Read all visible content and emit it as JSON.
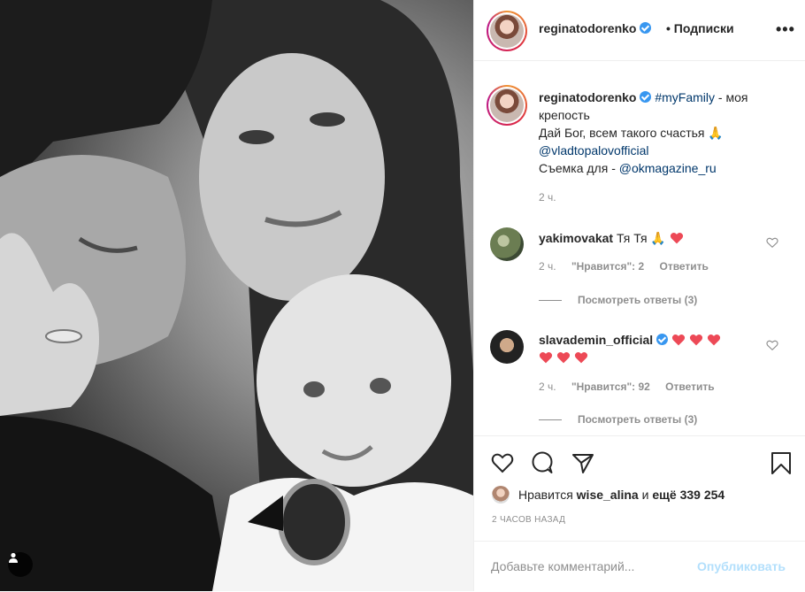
{
  "post": {
    "username": "reginatodorenko",
    "follow_separator": "•",
    "follow_label": "Подписки",
    "more_icon": "more-options-icon"
  },
  "caption": {
    "username": "reginatodorenko",
    "hashtag": "#myFamily",
    "line1_rest": " - моя крепость",
    "line2": "Дай Бог, всем такого счастья 🙏",
    "mention1": "@vladtopalovofficial",
    "line4_prefix": "Съемка для - ",
    "mention2": "@okmagazine_ru",
    "time": "2 ч."
  },
  "comments": [
    {
      "username": "yakimovakat",
      "text": "Тя Тя 🙏",
      "time": "2 ч.",
      "likes": "\"Нравится\": 2",
      "reply": "Ответить",
      "view_replies": "Посмотреть ответы (3)"
    },
    {
      "username": "slavademin_official",
      "text": "",
      "time": "2 ч.",
      "likes": "\"Нравится\": 92",
      "reply": "Ответить",
      "view_replies": "Посмотреть ответы (3)"
    }
  ],
  "actions": {
    "likes_prefix": "Нравится ",
    "likes_user": "wise_alina",
    "likes_mid": " и ",
    "likes_count": "ещё 339 254",
    "post_time": "2 часов назад"
  },
  "comment_box": {
    "placeholder": "Добавьте комментарий...",
    "publish_label": "Опубликовать"
  },
  "colors": {
    "verified": "#3897f0",
    "link": "#00376b",
    "muted": "#8e8e8e",
    "publish_disabled": "#b2dffc",
    "heart": "#ed4956"
  }
}
